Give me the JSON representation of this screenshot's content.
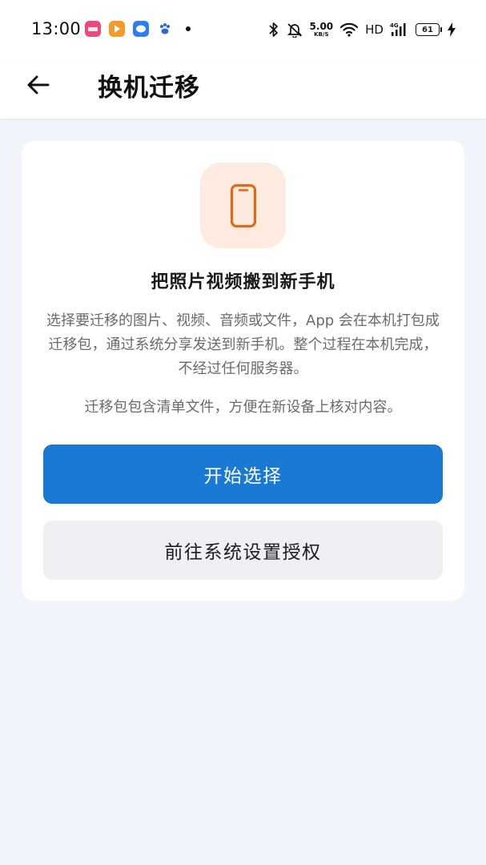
{
  "status_bar": {
    "time": "13:00",
    "net_speed_value": "5.00",
    "net_speed_unit": "KB/S",
    "network_label": "HD",
    "cell_label": "4G",
    "battery_level": "61",
    "colors": {
      "app1": "#ec4a7c",
      "app2": "#f39a2b",
      "app3": "#2f7ef0",
      "app4": "#2f67d6"
    },
    "icons": [
      "bluetooth-icon",
      "mute-icon",
      "wifi-icon",
      "signal-icon",
      "battery-icon",
      "charging-icon"
    ]
  },
  "top_bar": {
    "back_icon": "arrow-left-icon",
    "title": "换机迁移"
  },
  "card": {
    "icon": "smartphone-icon",
    "icon_color": "#e26a15",
    "icon_bg": "#fdebdf",
    "headline": "把照片视频搬到新手机",
    "description": "选择要迁移的图片、视频、音频或文件，App 会在本机打包成迁移包，通过系统分享发送到新手机。整个过程在本机完成，不经过任何服务器。",
    "note": "迁移包包含清单文件，方便在新设备上核对内容。",
    "primary_button": "开始选择",
    "secondary_button": "前往系统设置授权",
    "accent_color": "#1a79d3"
  }
}
